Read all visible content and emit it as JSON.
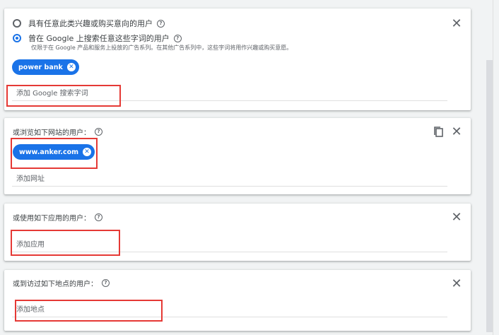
{
  "section_search_terms": {
    "option_interest": "具有任意此类兴趣或购买意向的用户",
    "option_searched": "曾在 Google 上搜索任意这些字词的用户",
    "option_searched_desc": "仅限于在 Google 产品和服务上投放的广告系列。在其他广告系列中，这些字词将用作兴趣或购买意愿。",
    "chip_label": "power bank",
    "input_placeholder": "添加 Google 搜索字词"
  },
  "section_websites": {
    "title": "或浏览如下网站的用户：",
    "chip_label": "www.anker.com",
    "input_placeholder": "添加网址"
  },
  "section_apps": {
    "title": "或使用如下应用的用户：",
    "input_placeholder": "添加应用"
  },
  "section_places": {
    "title": "或到访过如下地点的用户：",
    "input_placeholder": "添加地点"
  },
  "icons": {
    "close": "close-icon",
    "copy": "copy-icon",
    "help": "help-icon",
    "chip_remove": "chip-remove-icon"
  },
  "colors": {
    "accent": "#1a73e8",
    "highlight": "#e53935"
  }
}
